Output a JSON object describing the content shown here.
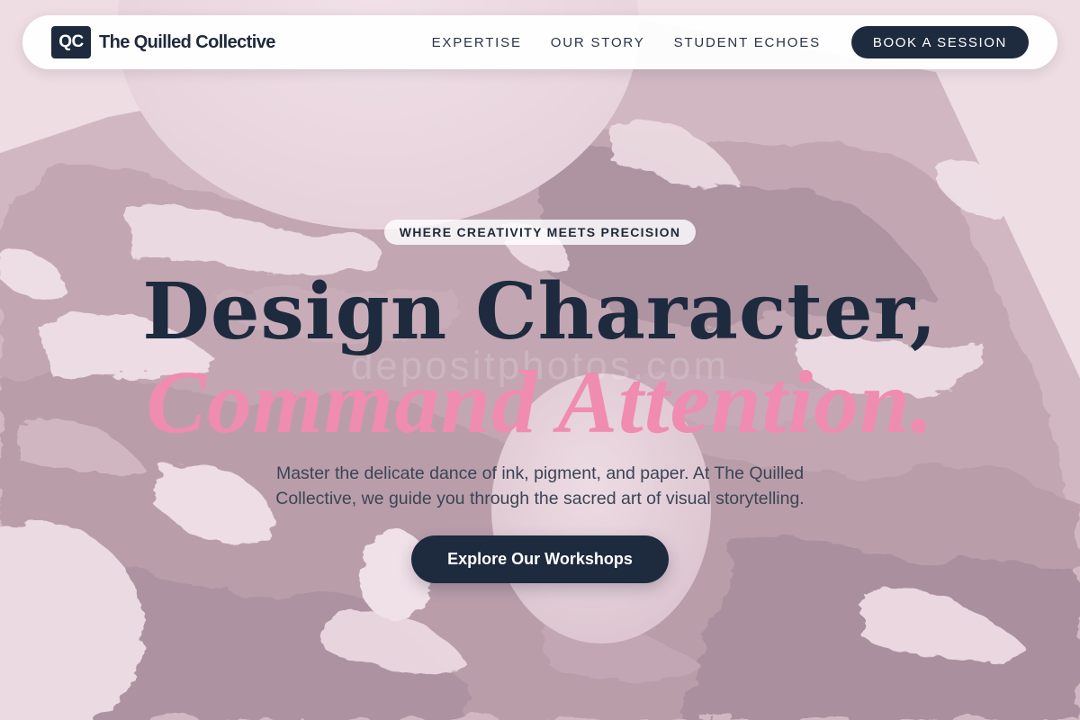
{
  "nav": {
    "logo_mark": "QC",
    "logo_text": "The Quilled Collective",
    "links": [
      {
        "label": "EXPERTISE"
      },
      {
        "label": "OUR STORY"
      },
      {
        "label": "STUDENT ECHOES"
      }
    ],
    "cta_label": "BOOK A SESSION"
  },
  "hero": {
    "eyebrow": "WHERE CREATIVITY MEETS PRECISION",
    "headline_line1": "Design Character,",
    "headline_line2": "Command Attention.",
    "watermark": "depositphotos.com",
    "subtext": "Master the delicate dance of ink, pigment, and paper. At The Quilled Collective, we guide you through the sacred art of visual storytelling.",
    "cta_label": "Explore Our Workshops"
  },
  "colors": {
    "navy": "#1e2a3e",
    "pink_accent": "#ef8cb0",
    "background": "#eddde2",
    "paint_dark": "#b999a6",
    "paint_light": "#f3e4ea"
  }
}
